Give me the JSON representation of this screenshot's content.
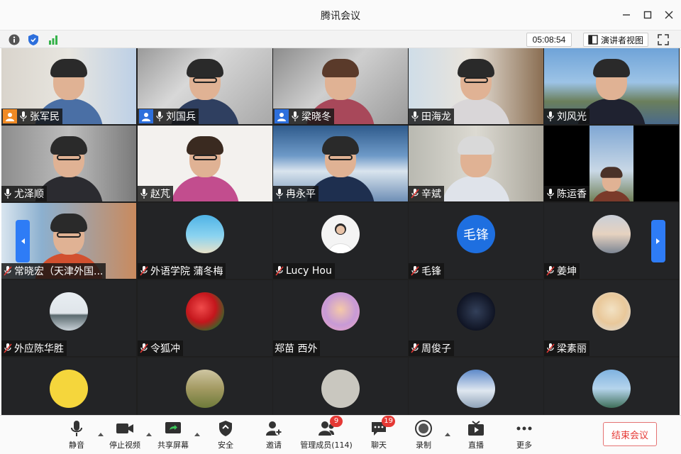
{
  "window": {
    "title": "腾讯会议"
  },
  "status": {
    "timer": "05:08:54",
    "speaker_view_label": "演讲者视图"
  },
  "participants": [
    {
      "name": "张军民",
      "badge": "host"
    },
    {
      "name": "刘国兵",
      "badge": "cohost"
    },
    {
      "name": "梁晓冬",
      "badge": "cohost"
    },
    {
      "name": "田海龙"
    },
    {
      "name": "刘风光"
    },
    {
      "name": "尤泽顺"
    },
    {
      "name": "赵芃"
    },
    {
      "name": "冉永平"
    },
    {
      "name": "辛斌"
    },
    {
      "name": "陈运香"
    },
    {
      "name": "常晓宏（天津外国..."
    },
    {
      "name": "外语学院 蒲冬梅"
    },
    {
      "name": "Lucy Hou"
    },
    {
      "name": "毛锋",
      "avatar_text": "毛锋"
    },
    {
      "name": "姜坤"
    },
    {
      "name": "外应陈华胜"
    },
    {
      "name": "令狐冲"
    },
    {
      "name": "郑苗 西外"
    },
    {
      "name": "周俊子"
    },
    {
      "name": "梁素丽"
    },
    {
      "name": ""
    },
    {
      "name": ""
    },
    {
      "name": ""
    },
    {
      "name": ""
    },
    {
      "name": ""
    }
  ],
  "toolbar": {
    "mute": "静音",
    "stop_video": "停止视频",
    "share_screen": "共享屏幕",
    "security": "安全",
    "invite": "邀请",
    "manage_members": "管理成员(114)",
    "manage_badge": "9",
    "chat": "聊天",
    "chat_badge": "19",
    "record": "录制",
    "live": "直播",
    "more": "更多",
    "end_meeting": "结束会议"
  },
  "colors": {
    "accent": "#2e7cf6",
    "host": "#f08a24",
    "danger": "#e53935",
    "muted_mic": "#e53935"
  }
}
